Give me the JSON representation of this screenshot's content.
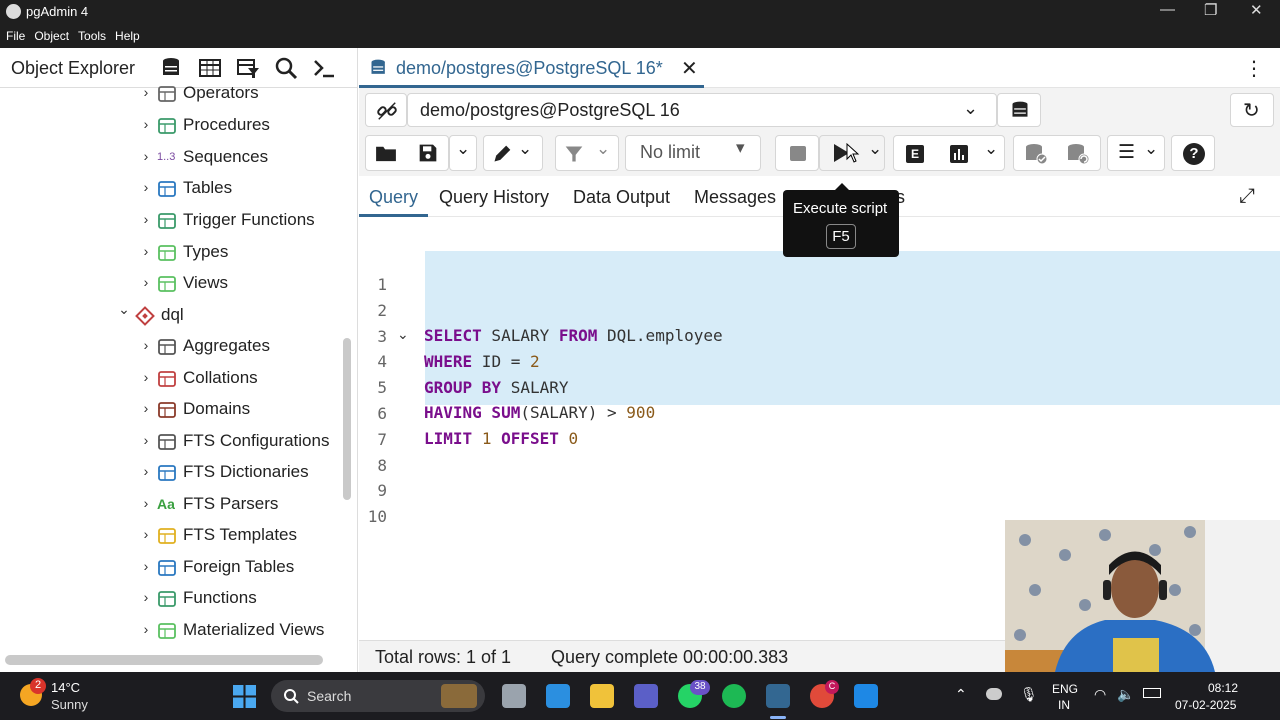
{
  "window": {
    "title": "pgAdmin 4",
    "minimize": "—",
    "maximize": "❐",
    "close": "✕"
  },
  "menu": [
    "File",
    "Object",
    "Tools",
    "Help"
  ],
  "object_explorer": {
    "title": "Object Explorer",
    "tree": [
      {
        "label": "Operators",
        "icon": "operator-icon",
        "expanded": false
      },
      {
        "label": "Procedures",
        "icon": "procedure-icon",
        "expanded": false
      },
      {
        "label": "Sequences",
        "icon": "sequence-icon",
        "expanded": false
      },
      {
        "label": "Tables",
        "icon": "table-icon",
        "expanded": false
      },
      {
        "label": "Trigger Functions",
        "icon": "trigger-function-icon",
        "expanded": false
      },
      {
        "label": "Types",
        "icon": "type-icon",
        "expanded": false
      },
      {
        "label": "Views",
        "icon": "view-icon",
        "expanded": false
      },
      {
        "label": "dql",
        "icon": "schema-icon",
        "expanded": true
      },
      {
        "label": "Aggregates",
        "icon": "aggregate-icon",
        "expanded": false
      },
      {
        "label": "Collations",
        "icon": "collation-icon",
        "expanded": false
      },
      {
        "label": "Domains",
        "icon": "domain-icon",
        "expanded": false
      },
      {
        "label": "FTS Configurations",
        "icon": "fts-config-icon",
        "expanded": false
      },
      {
        "label": "FTS Dictionaries",
        "icon": "fts-dictionary-icon",
        "expanded": false
      },
      {
        "label": "FTS Parsers",
        "icon": "fts-parser-icon",
        "expanded": false
      },
      {
        "label": "FTS Templates",
        "icon": "fts-template-icon",
        "expanded": false
      },
      {
        "label": "Foreign Tables",
        "icon": "foreign-table-icon",
        "expanded": false
      },
      {
        "label": "Functions",
        "icon": "function-icon",
        "expanded": false
      },
      {
        "label": "Materialized Views",
        "icon": "materialized-view-icon",
        "expanded": false
      }
    ],
    "sequence_icon_text": "1..3",
    "parser_icon_text": "Aa"
  },
  "query_tool": {
    "tab_title": "demo/postgres@PostgreSQL 16*",
    "connection": "demo/postgres@PostgreSQL 16",
    "limit": "No limit",
    "subtabs": [
      "Query",
      "Query History",
      "Data Output",
      "Messages",
      "Notifications"
    ],
    "subtab_visible": [
      "Query",
      "Query History",
      "Data Output",
      "Messages",
      "N",
      "ns"
    ],
    "line_numbers": [
      "1",
      "2",
      "3",
      "4",
      "5",
      "6",
      "7",
      "8",
      "9",
      "10"
    ],
    "tooltip": {
      "title": "Execute script",
      "key": "F5"
    },
    "status": {
      "rows": "Total rows: 1 of 1",
      "time": "Query complete 00:00:00.383"
    },
    "explain_letter": "E"
  },
  "taskbar": {
    "weather_badge": "2",
    "temperature": "14°C",
    "condition": "Sunny",
    "search_placeholder": "Search",
    "whatsapp_badge": "38",
    "chrome_badge": "C",
    "lang_top": "ENG",
    "lang_bottom": "IN",
    "time": "08:12",
    "date": "07-02-2025"
  },
  "colors": {
    "accent": "#326690",
    "keyword": "#7a0e8c",
    "selection": "#d7ecf8"
  }
}
